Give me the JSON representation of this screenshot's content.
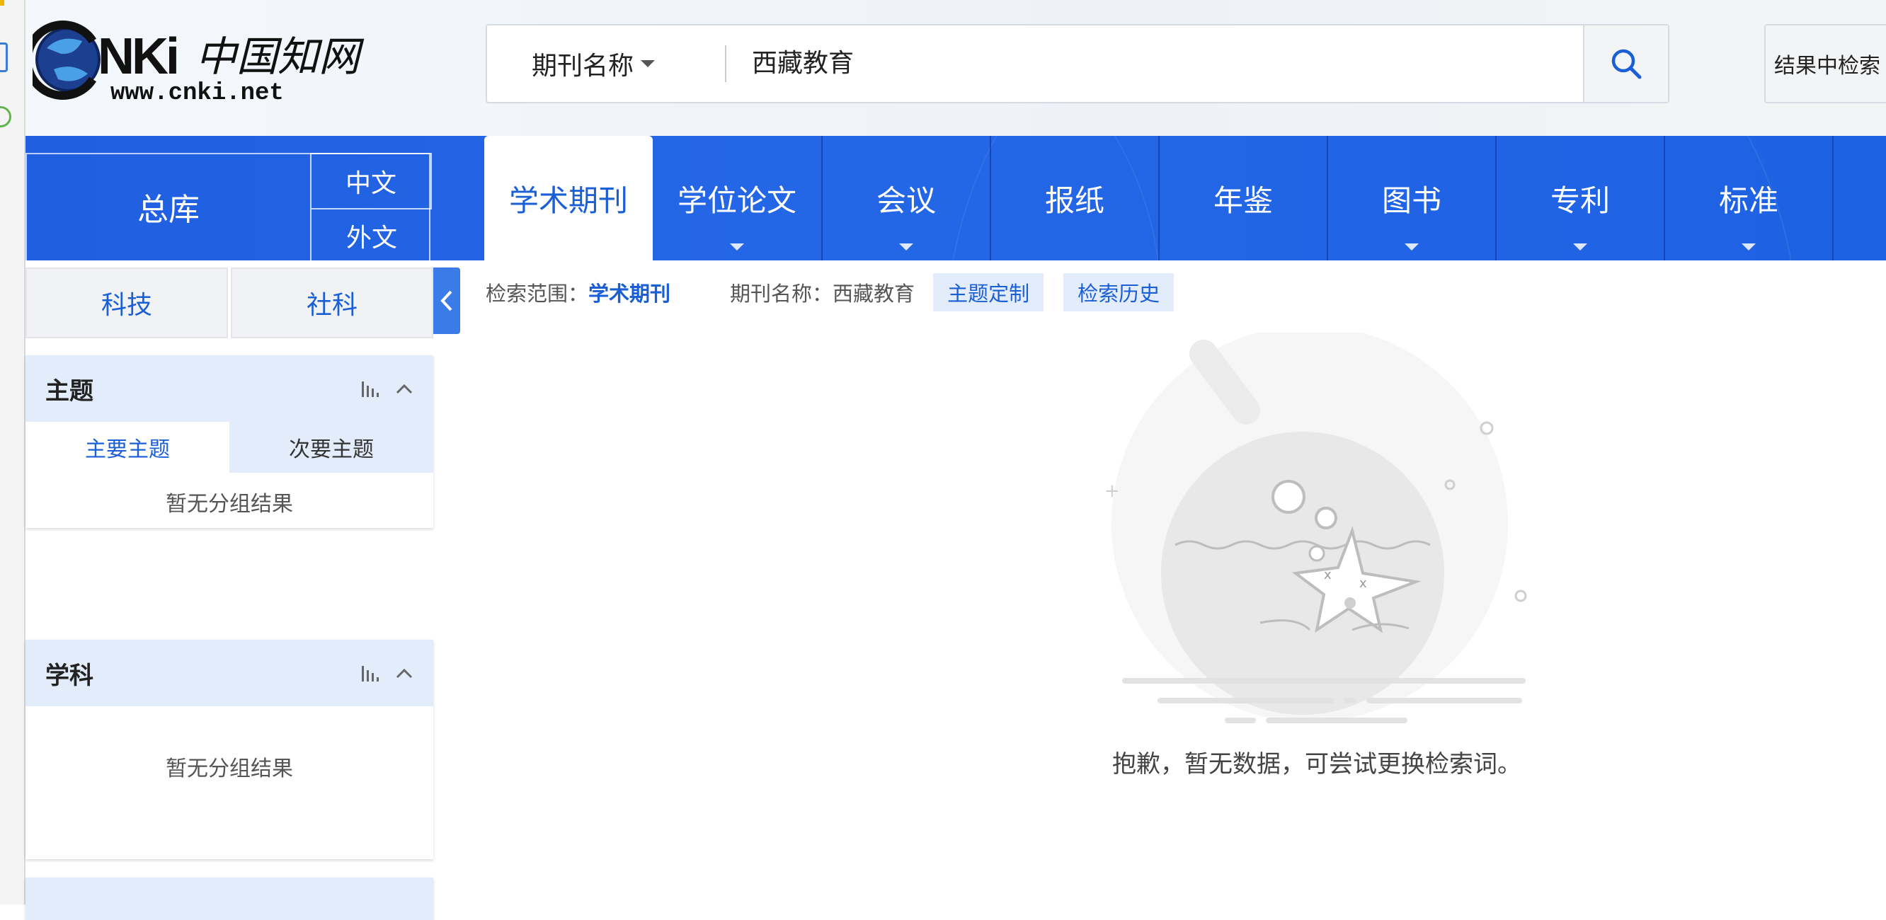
{
  "brand": {
    "logo_text": "CNKI中国知网",
    "logo_url_text": "www.cnki.net"
  },
  "search": {
    "field_label": "期刊名称",
    "query": "西藏教育",
    "submit_icon": "search-icon",
    "secondary_label": "结果中检索"
  },
  "nav": {
    "zongku": "总库",
    "lang_zh": "中文",
    "lang_en": "外文",
    "tabs": [
      "学术期刊",
      "学位论文",
      "会议",
      "报纸",
      "年鉴",
      "图书",
      "专利",
      "标准"
    ],
    "active_tab": "学术期刊",
    "color": "#1f5fe0"
  },
  "sidebar": {
    "categories": [
      "科技",
      "社科"
    ],
    "panels": [
      {
        "title": "主题",
        "subtabs": [
          "主要主题",
          "次要主题"
        ],
        "empty": "暂无分组结果"
      },
      {
        "title": "学科",
        "empty": "暂无分组结果"
      }
    ]
  },
  "results": {
    "scope_label": "检索范围：",
    "scope_value": "学术期刊",
    "query_label": "期刊名称：",
    "query_value": "西藏教育",
    "chip_topic": "主题定制",
    "chip_history": "检索历史",
    "empty_message": "抱歉，暂无数据，可尝试更换检索词。"
  },
  "accent": "#1b5fd6"
}
